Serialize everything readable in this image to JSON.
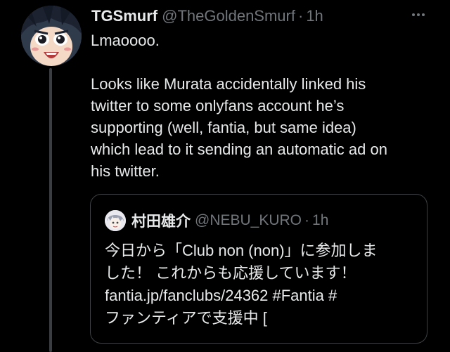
{
  "tweet": {
    "display_name": "TGSmurf",
    "handle": "@TheGoldenSmurf",
    "separator": "·",
    "time": "1h",
    "avatar_icon": "anime-character-avatar",
    "text_lines": [
      "Lmaoooo.",
      "",
      "Looks like Murata accidentally linked his",
      "twitter to some onlyfans account he’s",
      "supporting (well, fantia, but same idea)",
      "which lead to it sending an automatic ad on",
      "his twitter."
    ]
  },
  "quote": {
    "display_name": "村田雄介",
    "handle": "@NEBU_KURO",
    "separator": "·",
    "time": "1h",
    "avatar_icon": "manga-character-avatar",
    "text_lines": [
      "今日から「Club non (non)」に参加しま",
      "した！ これからも応援しています！",
      "fantia.jp/fanclubs/24362 #Fantia #",
      "ファンティアで支援中 ["
    ]
  },
  "colors": {
    "background": "#000000",
    "primary_text": "#e7e9ea",
    "secondary_text": "#71767b",
    "border": "#3e4144"
  }
}
